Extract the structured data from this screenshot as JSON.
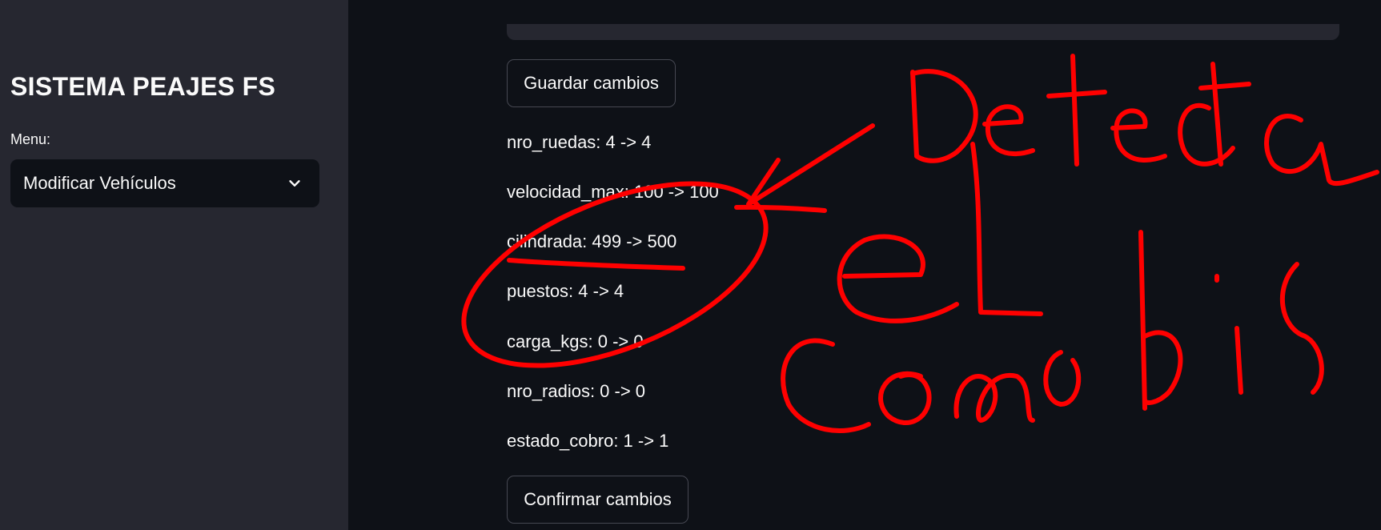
{
  "sidebar": {
    "title": "SISTEMA PEAJES FS",
    "menu_label": "Menu:",
    "menu_value": "Modificar Vehículos"
  },
  "main": {
    "save_button": "Guardar cambios",
    "changes": [
      "nro_ruedas: 4 -> 4",
      "velocidad_max: 100 -> 100",
      "cilindrada: 499 -> 500",
      "puestos: 4 -> 4",
      "carga_kgs: 0 -> 0",
      "nro_radios: 0 -> 0",
      "estado_cobro: 1 -> 1"
    ],
    "confirm_button": "Confirmar cambios"
  },
  "annotation": {
    "handwritten_text": "Detecta el cambio",
    "color": "#ff0000"
  },
  "colors": {
    "sidebar_bg": "#262730",
    "main_bg": "#0e1117",
    "text": "#fafafa",
    "annotation": "#ff0000"
  }
}
